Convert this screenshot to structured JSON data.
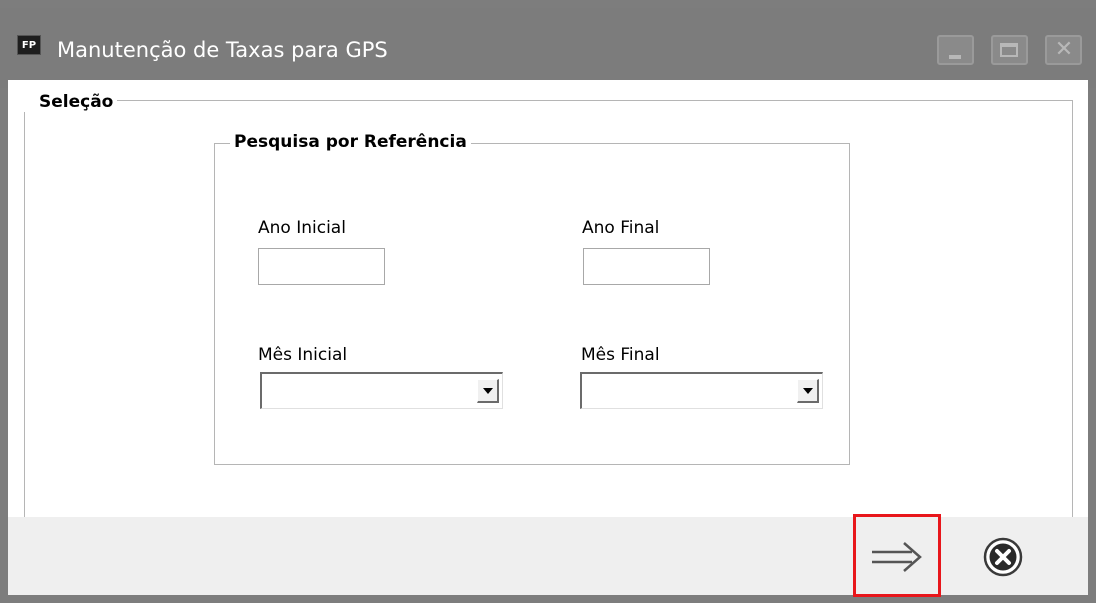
{
  "window": {
    "title": "Manutenção de Taxas para GPS",
    "app_icon_text": "FP",
    "buttons": [
      "minimize-icon",
      "maximize-icon",
      "close-icon"
    ]
  },
  "selection": {
    "title": "Seleção",
    "reference_search": {
      "title": "Pesquisa por Referência",
      "start_year_label": "Ano Inicial",
      "start_year_value": "",
      "end_year_label": "Ano Final",
      "end_year_value": "",
      "start_month_label": "Mês Inicial",
      "start_month_value": "",
      "end_month_label": "Mês Final",
      "end_month_value": ""
    }
  },
  "footer": {
    "next_icon": "double-arrow-right-icon",
    "close_icon": "circle-x-icon"
  },
  "colors": {
    "titlebar": "#7c7c7c",
    "highlight": "#e8161b",
    "footer": "#efefef"
  }
}
